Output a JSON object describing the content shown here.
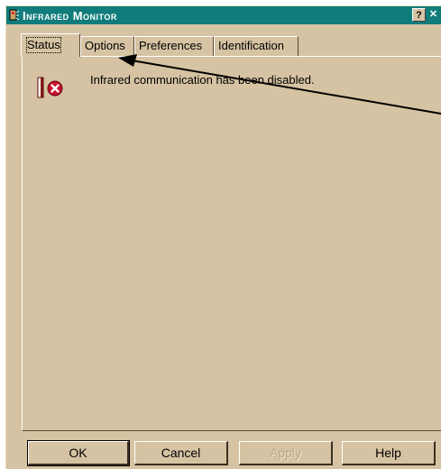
{
  "window": {
    "title": "Infrared Monitor",
    "icon": "infrared-app-icon",
    "help_button": "?",
    "close_button": "✕"
  },
  "tabs": [
    {
      "label": "Status",
      "active": true
    },
    {
      "label": "Options",
      "active": false
    },
    {
      "label": "Preferences",
      "active": false
    },
    {
      "label": "Identification",
      "active": false
    }
  ],
  "status": {
    "message": "Infrared communication has been disabled.",
    "icon": "infrared-disabled-icon"
  },
  "buttons": {
    "ok": "OK",
    "cancel": "Cancel",
    "apply": "Apply",
    "help": "Help"
  },
  "colors": {
    "titlebar": "#117c7c",
    "face": "#d6c3a3",
    "error_red": "#c8102e"
  }
}
